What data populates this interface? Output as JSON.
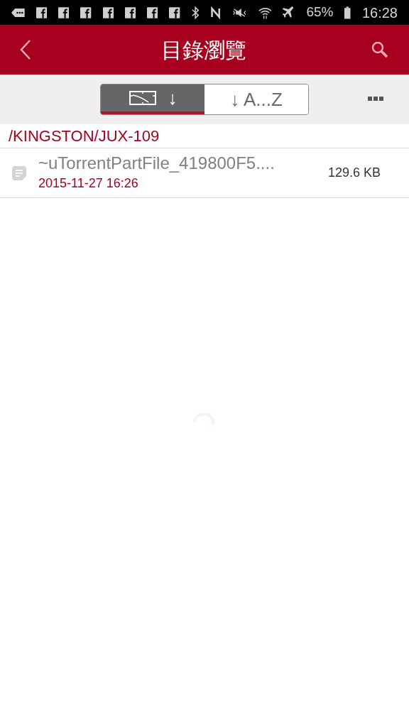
{
  "status_bar": {
    "battery": "65%",
    "time": "16:28"
  },
  "header": {
    "title": "目錄瀏覽"
  },
  "sort_tabs": [
    {
      "kind": "date",
      "label": "↓",
      "selected": true
    },
    {
      "kind": "name",
      "label": "↓ A...Z",
      "selected": false
    }
  ],
  "path": "/KINGSTON/JUX-109",
  "files": [
    {
      "name": "~uTorrentPartFile_419800F5....",
      "date": "2015-11-27 16:26",
      "size": "129.6 KB"
    }
  ]
}
